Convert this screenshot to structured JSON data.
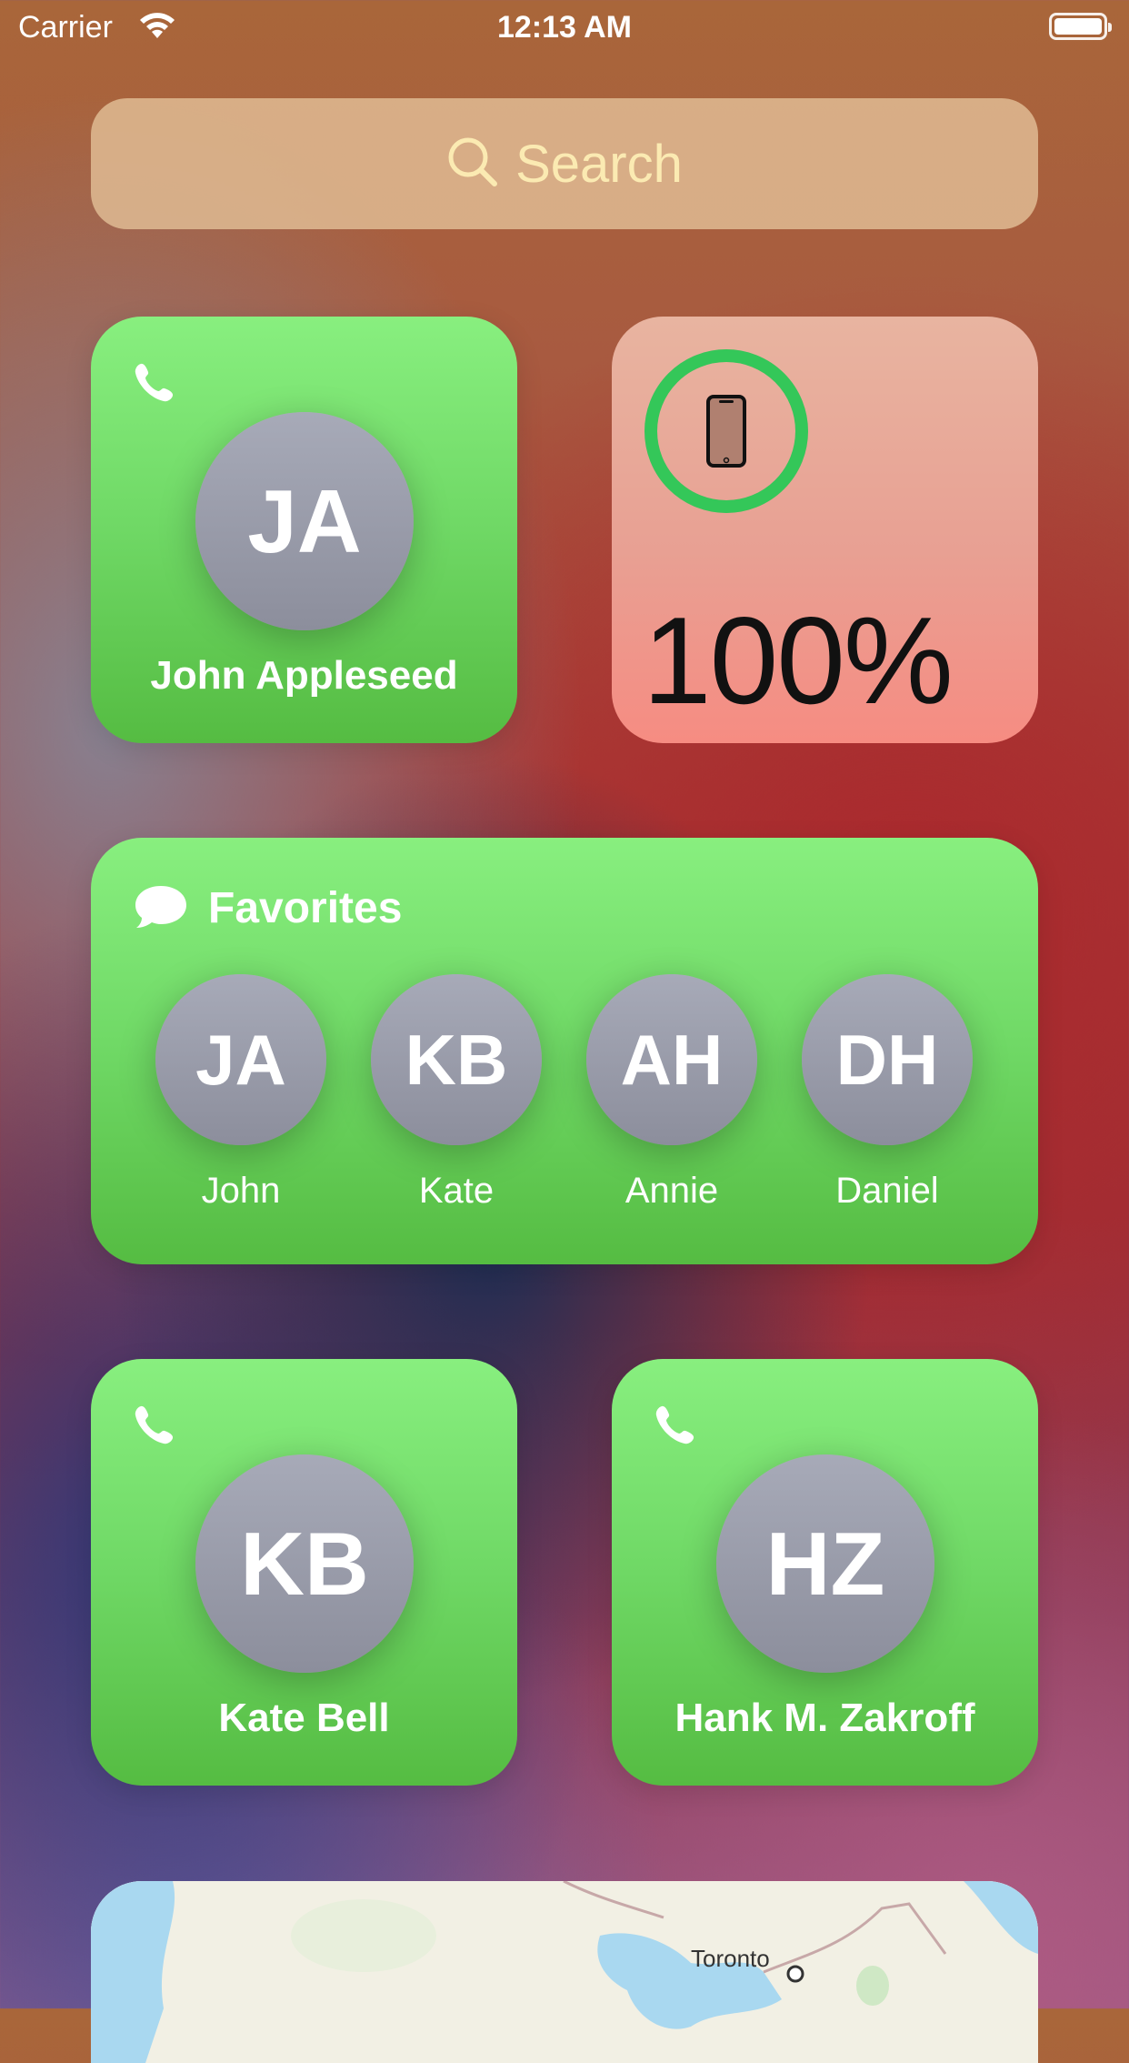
{
  "status_bar": {
    "carrier": "Carrier",
    "time": "12:13 AM",
    "battery_level": 1.0
  },
  "search": {
    "placeholder": "Search"
  },
  "contact_tiles": [
    {
      "initials": "JA",
      "name": "John Appleseed"
    },
    {
      "initials": "KB",
      "name": "Kate Bell"
    },
    {
      "initials": "HZ",
      "name": "Hank M. Zakroff"
    }
  ],
  "battery_widget": {
    "percent_label": "100%",
    "charge_fraction": 1.0,
    "ring_color": "#34c759"
  },
  "favorites": {
    "title": "Favorites",
    "items": [
      {
        "initials": "JA",
        "name": "John"
      },
      {
        "initials": "KB",
        "name": "Kate"
      },
      {
        "initials": "AH",
        "name": "Annie"
      },
      {
        "initials": "DH",
        "name": "Daniel"
      }
    ]
  },
  "map_widget": {
    "city_label": "Toronto"
  },
  "colors": {
    "widget_green": "#6fd865",
    "search_text": "#fbeab2"
  }
}
